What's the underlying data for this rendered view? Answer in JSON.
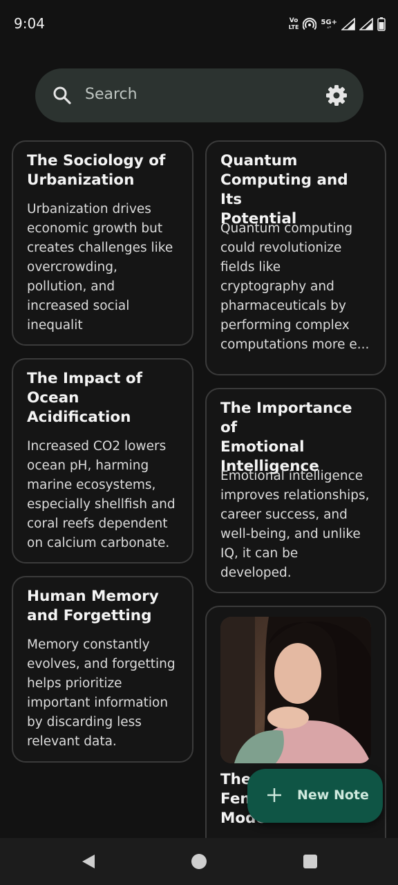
{
  "status": {
    "time": "9:04",
    "volte_top": "Vo",
    "volte_bottom": "LTE",
    "network": "5G+",
    "icons": [
      "volte-icon",
      "hotspot-icon",
      "signal-icon",
      "signal-icon",
      "battery-icon"
    ]
  },
  "search": {
    "placeholder": "Search",
    "icons": [
      "search-icon",
      "settings-icon"
    ]
  },
  "notes": [
    {
      "title": "The Sociology of Urbanization",
      "title_lines": [
        "The Sociology of",
        "Urbanization"
      ],
      "body_lines": [
        "Urbanization drives",
        "economic growth but",
        "creates challenges like",
        "overcrowding,",
        "pollution, and",
        "increased social",
        "inequalit"
      ]
    },
    {
      "title": "The Impact of Ocean Acidification",
      "title_lines": [
        "The Impact of",
        "Ocean",
        "Acidification"
      ],
      "body_lines": [
        "Increased CO2 lowers",
        "ocean pH, harming",
        "marine ecosystems,",
        "especially shellfish and",
        "coral reefs dependent",
        "on calcium carbonate."
      ]
    },
    {
      "title": "Human Memory and Forgetting",
      "title_lines": [
        "Human Memory",
        "and Forgetting"
      ],
      "body_lines": [
        "Memory constantly",
        "evolves, and forgetting",
        "helps prioritize",
        "important information",
        "by discarding less",
        "relevant data."
      ]
    },
    {
      "title": "Quantum Computing and Its Potential",
      "title_lines": [
        "Quantum",
        "Computing and Its",
        "Potential"
      ],
      "body_lines": [
        "Quantum computing",
        "could revolutionize",
        "fields like",
        "cryptography and",
        "pharmaceuticals by",
        "performing complex",
        "computations more e..."
      ]
    },
    {
      "title": "The Importance of Emotional Intelligence",
      "title_lines": [
        "The Importance of",
        "Emotional",
        "Intelligence"
      ],
      "body_lines": [
        "Emotional intelligence",
        "improves relationships,",
        "career success, and",
        "well-being, and unlike",
        "IQ, it can be",
        "developed."
      ]
    },
    {
      "title_lines": [
        "The",
        "Fen",
        "Mode"
      ],
      "image": "portrait-photo"
    }
  ],
  "fab": {
    "label": "New Note",
    "icon": "plus-icon"
  },
  "nav": {
    "icons": [
      "back-icon",
      "home-icon",
      "recents-icon"
    ]
  },
  "colors": {
    "background": "#121212",
    "card_border": "#3b3b3b",
    "search_bg": "#2c3330",
    "fab_bg": "#0f5545",
    "fab_text": "#cfe9de"
  }
}
